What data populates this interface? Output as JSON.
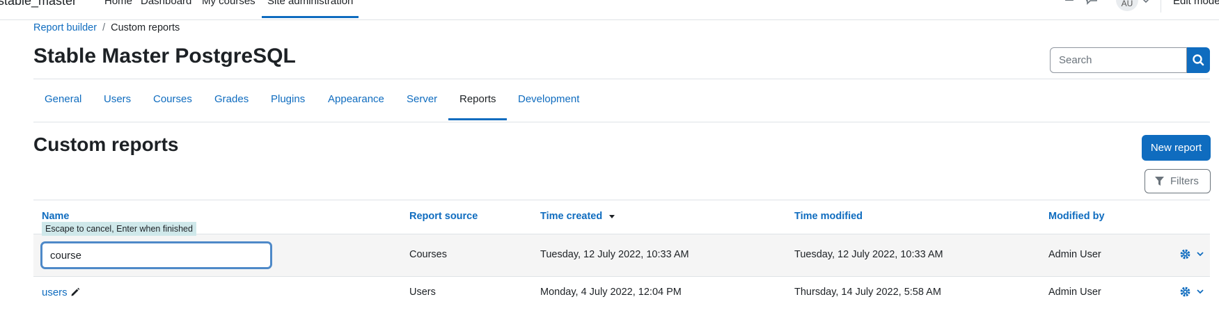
{
  "topnav": {
    "brand": "stable_master",
    "links": [
      "Home",
      "Dashboard",
      "My courses",
      "Site administration"
    ],
    "avatar_initials": "AU",
    "edit_mode_label": "Edit mode"
  },
  "breadcrumb": [
    "Report builder",
    "Custom reports"
  ],
  "page_title": "Stable Master PostgreSQL",
  "search": {
    "placeholder": "Search"
  },
  "tabs": [
    "General",
    "Users",
    "Courses",
    "Grades",
    "Plugins",
    "Appearance",
    "Server",
    "Reports",
    "Development"
  ],
  "active_tab": "Reports",
  "section_title": "Custom reports",
  "buttons": {
    "new_report": "New report",
    "filters": "Filters"
  },
  "table": {
    "columns": [
      "Name",
      "Report source",
      "Time created",
      "Time modified",
      "Modified by"
    ],
    "edit_hint": "Escape to cancel, Enter when finished",
    "rows": [
      {
        "name": "course",
        "source": "Courses",
        "created": "Tuesday, 12 July 2022, 10:33 AM",
        "modified": "Tuesday, 12 July 2022, 10:33 AM",
        "by": "Admin User"
      },
      {
        "name": "users",
        "source": "Users",
        "created": "Monday, 4 July 2022, 12:04 PM",
        "modified": "Thursday, 14 July 2022, 5:58 AM",
        "by": "Admin User"
      }
    ]
  },
  "colors": {
    "primary": "#0f6cbf",
    "text": "#1d2125",
    "muted": "#6a737b"
  }
}
